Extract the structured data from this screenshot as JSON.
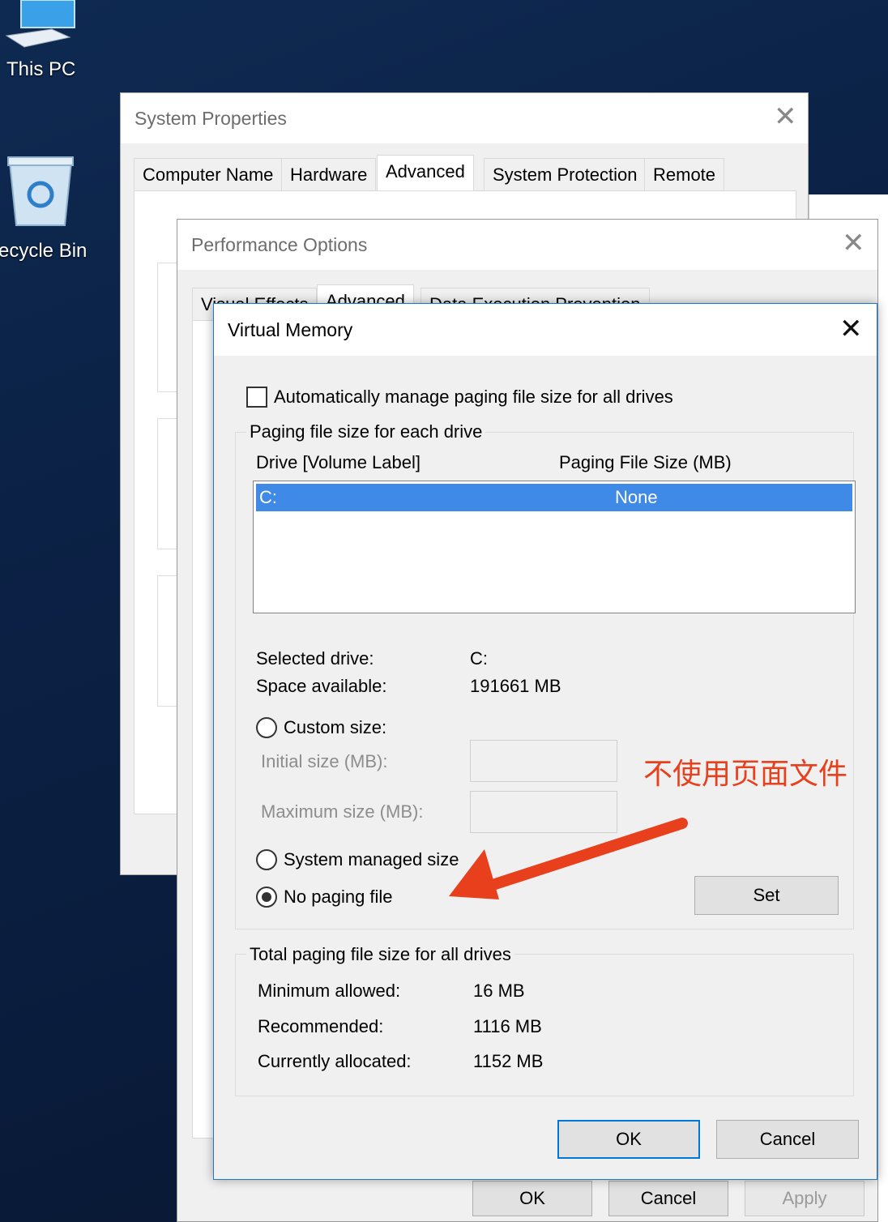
{
  "desktop": {
    "this_pc_label": "This PC",
    "recycle_bin_label": "ecycle Bin"
  },
  "system_properties": {
    "title": "System Properties",
    "tabs": [
      "Computer Name",
      "Hardware",
      "Advanced",
      "System Protection",
      "Remote"
    ],
    "active_tab": "Advanced",
    "buttons": {
      "ok": "OK",
      "cancel": "Cancel",
      "apply": "Apply"
    }
  },
  "performance_options": {
    "title": "Performance Options",
    "tabs": [
      "Visual Effects",
      "Advanced",
      "Data Execution Prevention"
    ],
    "active_tab": "Advanced"
  },
  "virtual_memory": {
    "title": "Virtual Memory",
    "auto_manage_label": "Automatically manage paging file size for all drives",
    "auto_manage_checked": false,
    "paging_group_title": "Paging file size for each drive",
    "col_drive": "Drive  [Volume Label]",
    "col_size": "Paging File Size (MB)",
    "drives": [
      {
        "drive": "C:",
        "size": "None",
        "selected": true
      }
    ],
    "selected_drive_label": "Selected drive:",
    "selected_drive_value": "C:",
    "space_available_label": "Space available:",
    "space_available_value": "191661 MB",
    "custom_size_label": "Custom size:",
    "initial_size_label": "Initial size (MB):",
    "maximum_size_label": "Maximum size (MB):",
    "initial_size_value": "",
    "maximum_size_value": "",
    "system_managed_label": "System managed size",
    "no_paging_label": "No paging file",
    "selected_option": "no_paging",
    "set_button": "Set",
    "total_group_title": "Total paging file size for all drives",
    "minimum_label": "Minimum allowed:",
    "minimum_value": "16 MB",
    "recommended_label": "Recommended:",
    "recommended_value": "1116 MB",
    "allocated_label": "Currently allocated:",
    "allocated_value": "1152 MB",
    "ok_button": "OK",
    "cancel_button": "Cancel"
  },
  "annotation": {
    "text": "不使用页面文件",
    "color": "#e8401c"
  }
}
